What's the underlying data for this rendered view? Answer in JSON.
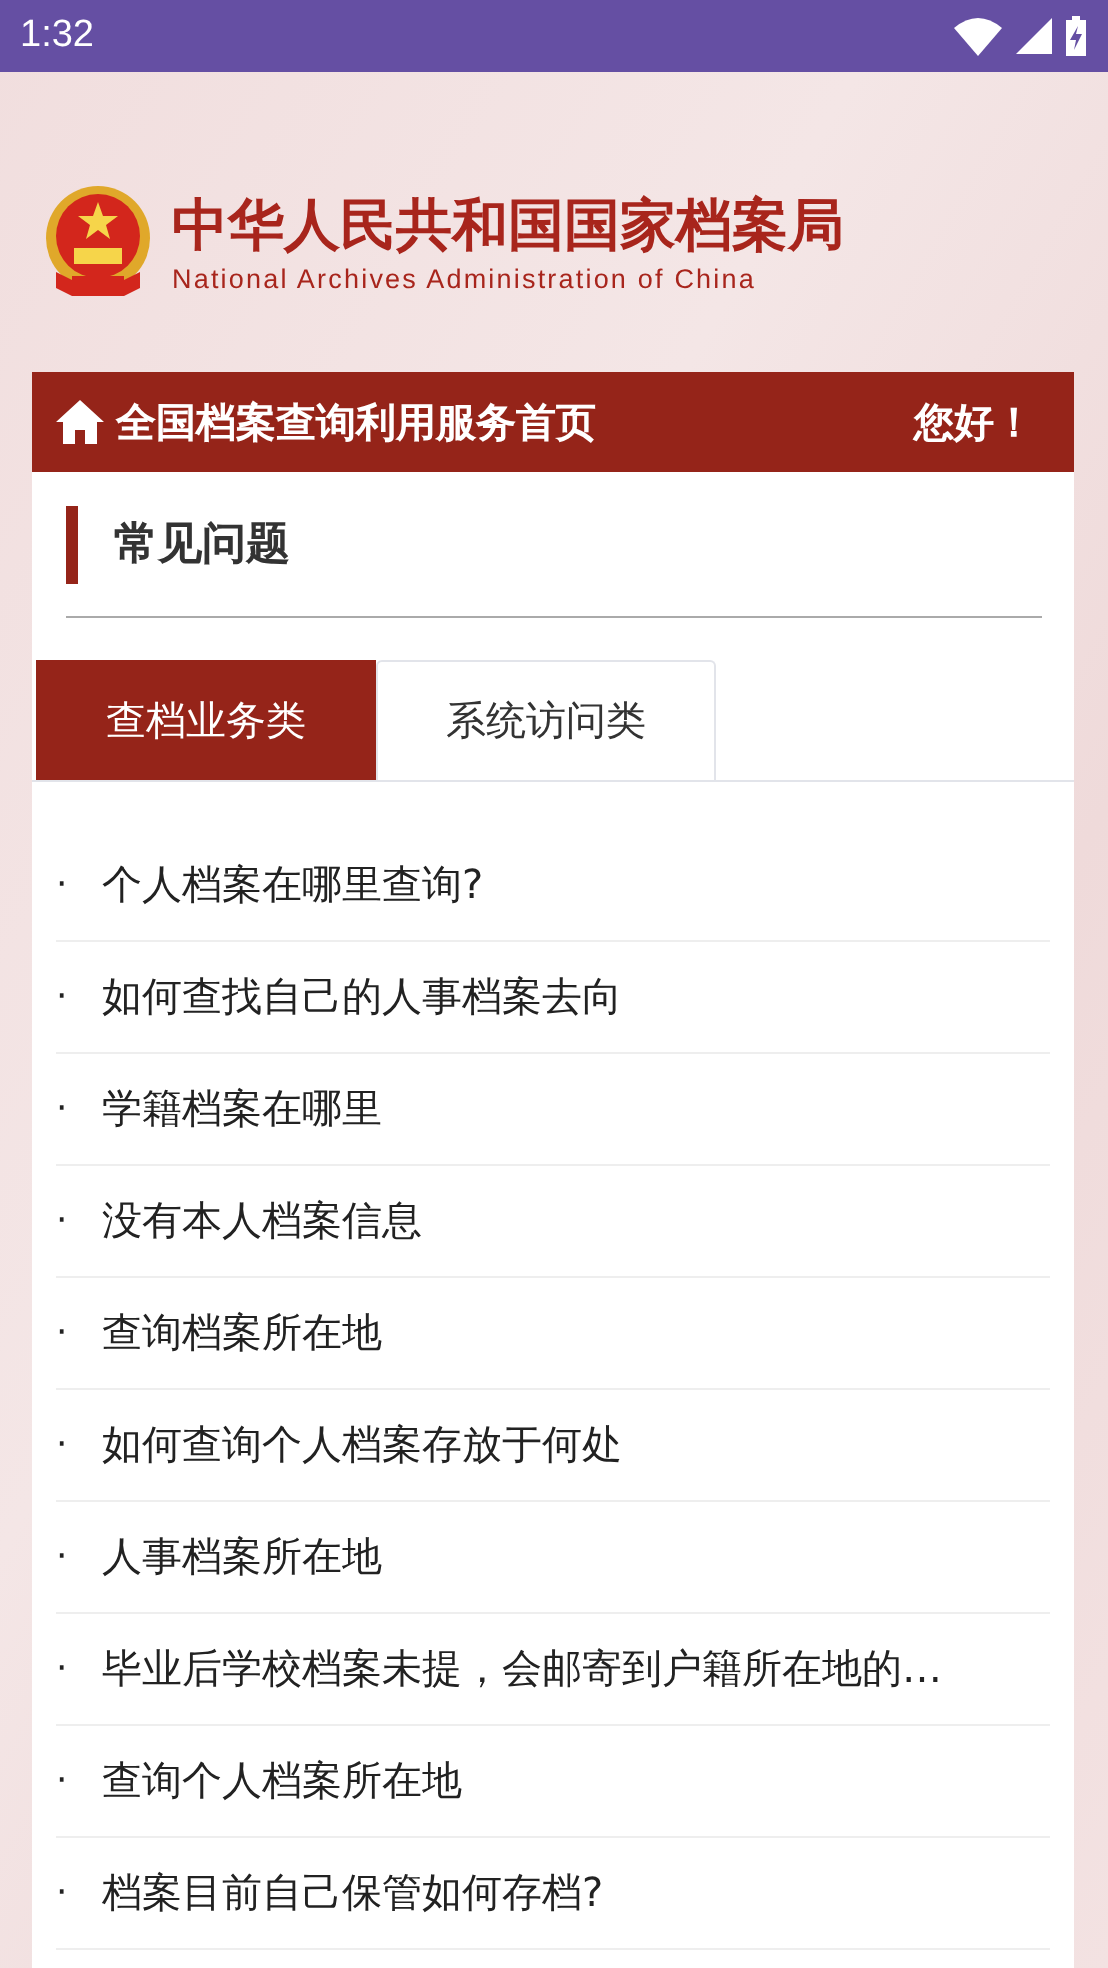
{
  "status_bar": {
    "time": "1:32"
  },
  "header": {
    "title": "中华人民共和国国家档案局",
    "subtitle": "National Archives Administration of China"
  },
  "nav_bar": {
    "title": "全国档案查询利用服务首页",
    "greeting": "您好！"
  },
  "section": {
    "title": "常见问题"
  },
  "tabs": [
    {
      "label": "查档业务类",
      "selected": true
    },
    {
      "label": "系统访问类",
      "selected": false
    }
  ],
  "questions": [
    {
      "bullet": "·",
      "text": "个人档案在哪里查询?"
    },
    {
      "bullet": "·",
      "text": "如何查找自己的人事档案去向"
    },
    {
      "bullet": "·",
      "text": "学籍档案在哪里"
    },
    {
      "bullet": "·",
      "text": "没有本人档案信息"
    },
    {
      "bullet": "·",
      "text": "查询档案所在地"
    },
    {
      "bullet": "·",
      "text": "如何查询个人档案存放于何处"
    },
    {
      "bullet": "·",
      "text": "人事档案所在地"
    },
    {
      "bullet": "·",
      "text": "毕业后学校档案未提，会邮寄到户籍所在地的…"
    },
    {
      "bullet": "·",
      "text": "查询个人档案所在地"
    },
    {
      "bullet": "·",
      "text": "档案目前自己保管如何存档?"
    }
  ]
}
